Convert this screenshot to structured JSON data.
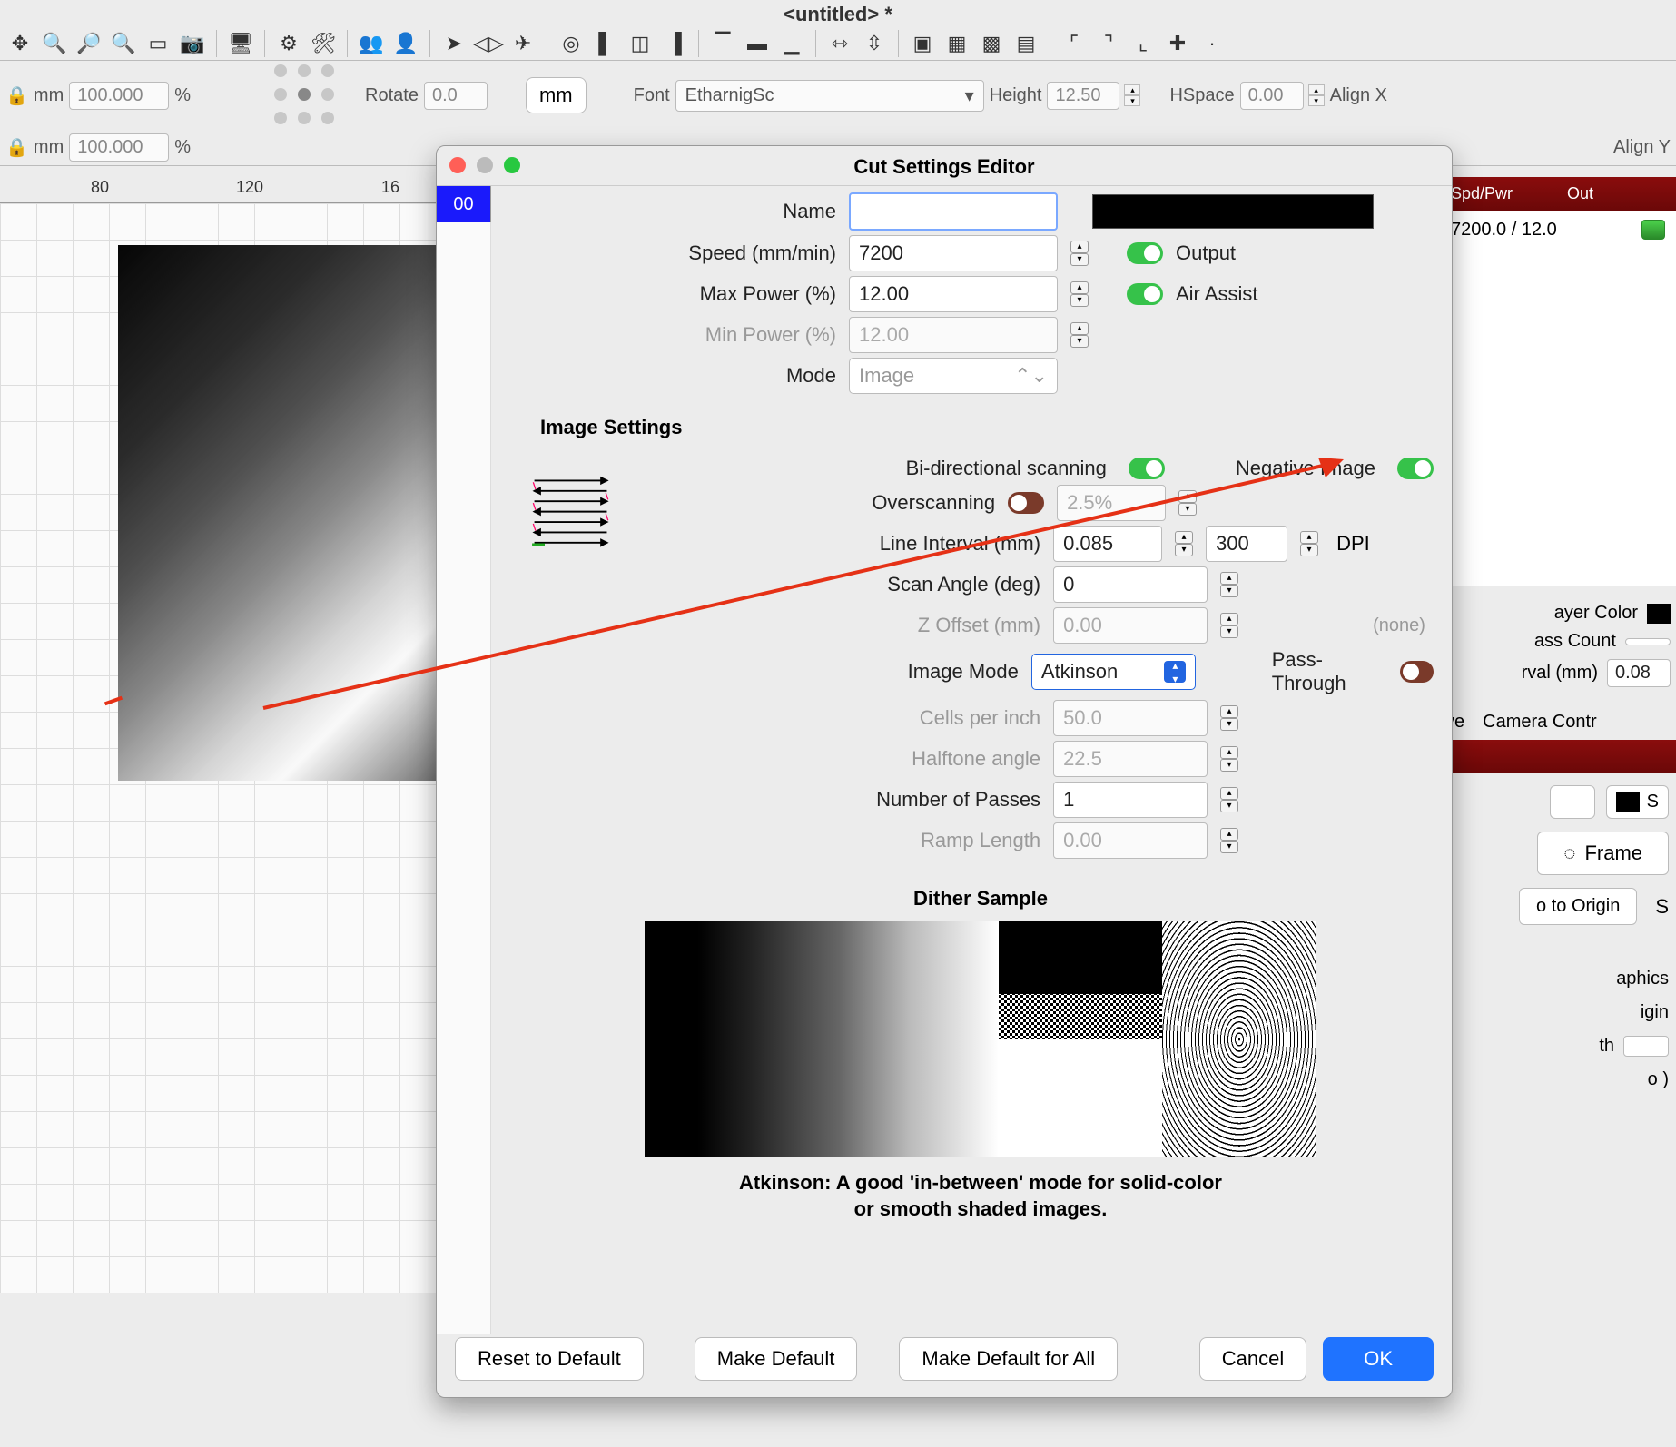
{
  "window": {
    "title": "<untitled> *"
  },
  "propbar": {
    "x_unit": "mm",
    "x_val": "100.000",
    "x_pct": "%",
    "y_unit": "mm",
    "y_val": "100.000",
    "y_pct": "%",
    "rotate_label": "Rotate",
    "rotate_val": "0.0",
    "unitbtn": "mm",
    "font_label": "Font",
    "font_val": "EtharnigSc",
    "height_label": "Height",
    "height_val": "12.50",
    "hspace_label": "HSpace",
    "hspace_val": "0.00",
    "alignx": "Align X",
    "aligny": "Align Y"
  },
  "ruler": {
    "t1": "80",
    "t2": "120",
    "t3": "16"
  },
  "rightpanel": {
    "hdr_spdpwr": "Spd/Pwr",
    "hdr_out": "Out",
    "row1": "7200.0 / 12.0",
    "layer_color": "ayer Color",
    "pass_count": "ass Count",
    "interval": "rval (mm)",
    "interval_val": "0.08",
    "tab_move": "ve",
    "tab_camera": "Camera Contr",
    "frame": "Frame",
    "go_origin": "o to Origin",
    "letter_s1": "S",
    "letter_s2": "S",
    "graphics": "aphics",
    "origin": "igin",
    "th": "th",
    "o_paren": "o )"
  },
  "dialog": {
    "title": "Cut Settings Editor",
    "sidetab": "00",
    "name_label": "Name",
    "name_val": "",
    "speed_label": "Speed (mm/min)",
    "speed_val": "7200",
    "maxpower_label": "Max Power (%)",
    "maxpower_val": "12.00",
    "minpower_label": "Min Power (%)",
    "minpower_val": "12.00",
    "mode_label": "Mode",
    "mode_val": "Image",
    "output_label": "Output",
    "air_label": "Air Assist",
    "section_image": "Image Settings",
    "bidir_label": "Bi-directional scanning",
    "neg_label": "Negative Image",
    "overscan_label": "Overscanning",
    "overscan_val": "2.5%",
    "lineint_label": "Line Interval (mm)",
    "lineint_val": "0.085",
    "dpi_val": "300",
    "dpi_label": "DPI",
    "scanangle_label": "Scan Angle (deg)",
    "scanangle_val": "0",
    "zoffset_label": "Z Offset (mm)",
    "zoffset_val": "0.00",
    "zoffset_none": "(none)",
    "imagemode_label": "Image Mode",
    "imagemode_val": "Atkinson",
    "passthrough_label": "Pass-Through",
    "cpi_label": "Cells per inch",
    "cpi_val": "50.0",
    "halftone_label": "Halftone angle",
    "halftone_val": "22.5",
    "passes_label": "Number of Passes",
    "passes_val": "1",
    "ramp_label": "Ramp Length",
    "ramp_val": "0.00",
    "dither_title": "Dither Sample",
    "dither_desc1": "Atkinson: A good 'in-between' mode for solid-color",
    "dither_desc2": "or smooth shaded images.",
    "btn_reset": "Reset to Default",
    "btn_makedef": "Make Default",
    "btn_makedefall": "Make Default for All",
    "btn_cancel": "Cancel",
    "btn_ok": "OK"
  }
}
